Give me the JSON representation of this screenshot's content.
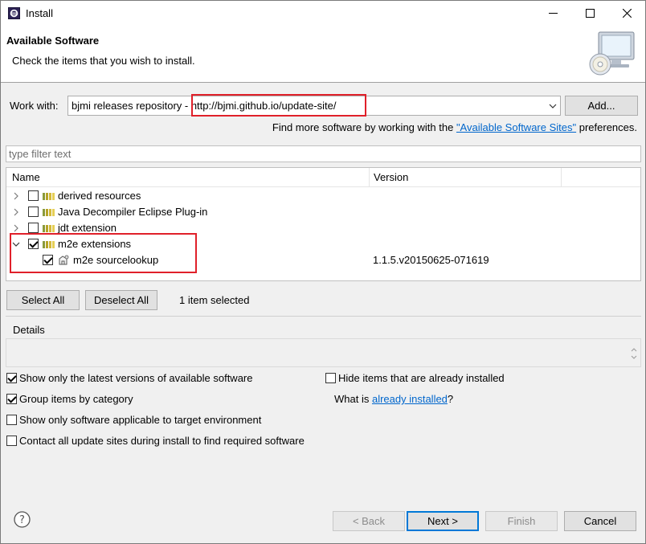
{
  "window": {
    "title": "Install",
    "icons": {
      "app": "eclipse-icon",
      "minimize": "minimize-icon",
      "maximize": "maximize-icon",
      "close": "close-icon"
    }
  },
  "banner": {
    "title": "Available Software",
    "description": "Check the items that you wish to install.",
    "image": "computer-cd-icon"
  },
  "work_with": {
    "label": "Work with:",
    "value": "bjmi releases repository - http://bjmi.github.io/update-site/",
    "add_label": "Add..."
  },
  "find_more": {
    "prefix": "Find more software by working with the ",
    "link": "\"Available Software Sites\"",
    "suffix": " preferences."
  },
  "filter": {
    "placeholder": "type filter text"
  },
  "tree": {
    "columns": [
      "Name",
      "Version"
    ],
    "rows": [
      {
        "label": "derived resources",
        "version": "",
        "checked": false,
        "expanded": false,
        "level": 0
      },
      {
        "label": "Java Decompiler Eclipse Plug-in",
        "version": "",
        "checked": false,
        "expanded": false,
        "level": 0
      },
      {
        "label": "jdt extension",
        "version": "",
        "checked": false,
        "expanded": false,
        "level": 0
      },
      {
        "label": "m2e extensions",
        "version": "",
        "checked": true,
        "expanded": true,
        "level": 0
      },
      {
        "label": "m2e sourcelookup",
        "version": "1.1.5.v20150625-071619",
        "checked": true,
        "expanded": false,
        "level": 1
      }
    ]
  },
  "selection": {
    "select_all": "Select All",
    "deselect_all": "Deselect All",
    "count": "1 item selected"
  },
  "details": {
    "label": "Details"
  },
  "options": {
    "latest_only": {
      "label": "Show only the latest versions of available software",
      "checked": true
    },
    "group_by_category": {
      "label": "Group items by category",
      "checked": true
    },
    "target_env": {
      "label": "Show only software applicable to target environment",
      "checked": false
    },
    "contact_all": {
      "label": "Contact all update sites during install to find required software",
      "checked": false
    },
    "hide_installed": {
      "label": "Hide items that are already installed",
      "checked": false
    },
    "what_is": {
      "prefix": "What is ",
      "link": "already installed",
      "suffix": "?"
    }
  },
  "footer": {
    "back": "< Back",
    "next": "Next >",
    "finish": "Finish",
    "cancel": "Cancel",
    "help_icon": "help-icon"
  },
  "colors": {
    "highlight": "#e0202a",
    "link": "#0066cc",
    "default_button": "#0078d7"
  }
}
